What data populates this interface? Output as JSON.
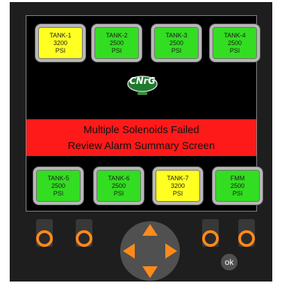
{
  "top_tanks": [
    {
      "name": "TANK-1",
      "value": "3200",
      "unit": "PSI",
      "status_color": "#ffff22"
    },
    {
      "name": "TANK-2",
      "value": "2500",
      "unit": "PSI",
      "status_color": "#33dd22"
    },
    {
      "name": "TANK-3",
      "value": "2500",
      "unit": "PSI",
      "status_color": "#33dd22"
    },
    {
      "name": "TANK-4",
      "value": "2500",
      "unit": "PSI",
      "status_color": "#33dd22"
    }
  ],
  "bottom_tanks": [
    {
      "name": "TANK-5",
      "value": "2500",
      "unit": "PSI",
      "status_color": "#33dd22"
    },
    {
      "name": "TANK-6",
      "value": "2500",
      "unit": "PSI",
      "status_color": "#33dd22"
    },
    {
      "name": "TANK-7",
      "value": "3200",
      "unit": "PSI",
      "status_color": "#ffff22"
    },
    {
      "name": "FMM",
      "value": "2500",
      "unit": "PSI",
      "status_color": "#33dd22"
    }
  ],
  "logo": {
    "text": "CNrG"
  },
  "alarm": {
    "line1": "Multiple Solenoids Failed",
    "line2": "Review Alarm Summary Screen",
    "color": "#ff1a1a"
  },
  "controls": {
    "ok_label": "ok",
    "accent_color": "#ff8a1a",
    "icons": [
      "up-arrow-icon",
      "down-arrow-icon",
      "left-arrow-icon",
      "right-arrow-icon"
    ]
  }
}
